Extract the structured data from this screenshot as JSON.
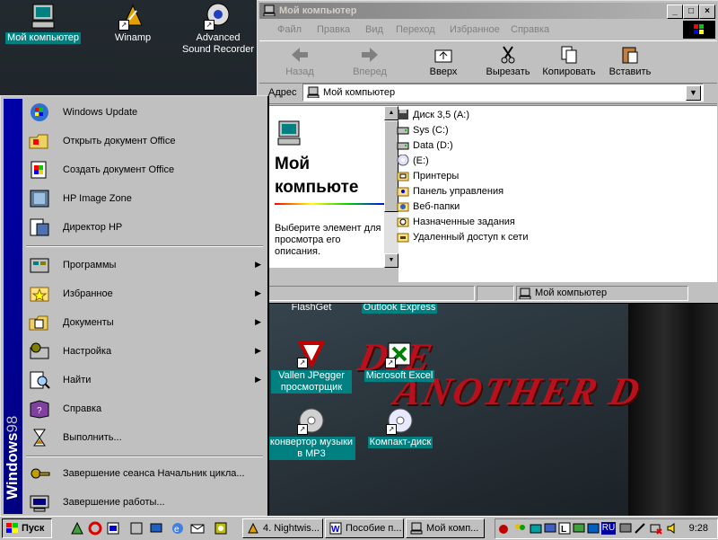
{
  "desktop": {
    "icons": [
      {
        "label": "Мой компьютер",
        "icon": "my-computer-icon"
      },
      {
        "label": "Winamp",
        "icon": "winamp-icon"
      },
      {
        "label": "Advanced Sound Recorder",
        "icon": "sound-recorder-icon"
      },
      {
        "label": "FlashGet",
        "icon": "flashget-icon"
      },
      {
        "label": "Outlook Express",
        "icon": "outlook-express-icon"
      },
      {
        "label": "Vallen JPegger просмотрщик",
        "icon": "jpegger-icon"
      },
      {
        "label": "Microsoft Excel",
        "icon": "excel-icon"
      },
      {
        "label": "конвертор музыки в MP3",
        "icon": "mp3-converter-icon"
      },
      {
        "label": "Компакт-диск",
        "icon": "cd-icon"
      }
    ],
    "wallpaper_text": [
      "DIE",
      "ANOTHER D"
    ]
  },
  "window": {
    "title": "Мой компьютер",
    "menu": [
      "Файл",
      "Правка",
      "Вид",
      "Переход",
      "Избранное",
      "Справка"
    ],
    "toolbar": {
      "back": "Назад",
      "forward": "Вперед",
      "up": "Вверх",
      "cut": "Вырезать",
      "copy": "Копировать",
      "paste": "Вставить"
    },
    "address_label": "Адрес",
    "address_value": "Мой компьютер",
    "left_pane": {
      "title": "Мой компьюте",
      "description": "Выберите элемент для просмотра его описания."
    },
    "items": [
      {
        "label": "Диск 3,5 (A:)",
        "icon": "floppy-icon"
      },
      {
        "label": "Sys (C:)",
        "icon": "hard-drive-icon"
      },
      {
        "label": "Data (D:)",
        "icon": "hard-drive-icon"
      },
      {
        "label": "(E:)",
        "icon": "cd-drive-icon"
      },
      {
        "label": "Принтеры",
        "icon": "printers-folder-icon"
      },
      {
        "label": "Панель управления",
        "icon": "control-panel-icon"
      },
      {
        "label": "Веб-папки",
        "icon": "web-folders-icon"
      },
      {
        "label": "Назначенные задания",
        "icon": "scheduled-tasks-icon"
      },
      {
        "label": "Удаленный доступ к сети",
        "icon": "dialup-icon"
      }
    ],
    "status_text": "Мой компьютер"
  },
  "start_menu": {
    "banner": {
      "brand": "Windows",
      "version": "98"
    },
    "top_items": [
      {
        "label": "Windows Update",
        "icon": "windows-update-icon"
      },
      {
        "label": "Открыть документ Office",
        "icon": "open-office-doc-icon"
      },
      {
        "label": "Создать документ Office",
        "icon": "new-office-doc-icon"
      },
      {
        "label": "HP  Image Zone",
        "icon": "hp-image-zone-icon"
      },
      {
        "label": "Директор HP",
        "icon": "hp-director-icon"
      }
    ],
    "main_items": [
      {
        "label": "Программы",
        "icon": "programs-icon",
        "submenu": true
      },
      {
        "label": "Избранное",
        "icon": "favorites-icon",
        "submenu": true
      },
      {
        "label": "Документы",
        "icon": "documents-icon",
        "submenu": true
      },
      {
        "label": "Настройка",
        "icon": "settings-icon",
        "submenu": true
      },
      {
        "label": "Найти",
        "icon": "find-icon",
        "submenu": true
      },
      {
        "label": "Справка",
        "icon": "help-icon",
        "submenu": false
      },
      {
        "label": "Выполнить...",
        "icon": "run-icon",
        "submenu": false
      }
    ],
    "bottom_items": [
      {
        "label": "Завершение сеанса Начальник цикла...",
        "icon": "logoff-icon"
      },
      {
        "label": "Завершение работы...",
        "icon": "shutdown-icon"
      }
    ]
  },
  "taskbar": {
    "start_label": "Пуск",
    "tasks": [
      {
        "label": "4. Nightwis...",
        "icon": "winamp-task-icon"
      },
      {
        "label": "Пособие п...",
        "icon": "word-task-icon"
      },
      {
        "label": "Мой комп...",
        "icon": "explorer-task-icon"
      }
    ],
    "clock": "9:28",
    "lang": "RU"
  }
}
